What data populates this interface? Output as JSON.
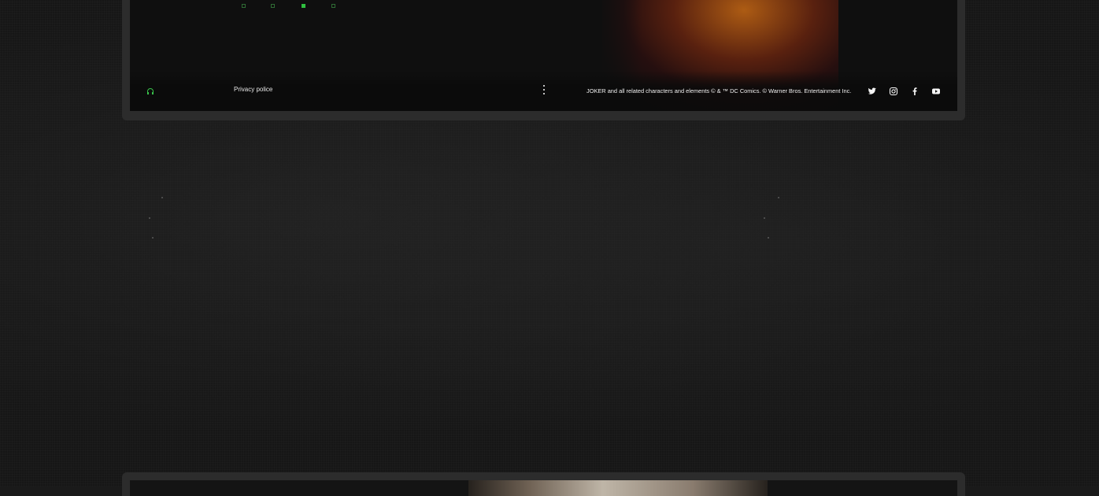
{
  "slider": {
    "dots": [
      {
        "state": "inactive"
      },
      {
        "state": "inactive"
      },
      {
        "state": "active"
      },
      {
        "state": "inactive"
      }
    ]
  },
  "footer": {
    "audio_icon": "headphones-icon",
    "privacy_label": "Privacy police",
    "menu_icon": "vertical-dots-icon",
    "copyright": "JOKER and all related characters and elements © & ™ DC Comics. © Warner Bros. Entertainment Inc.",
    "social": [
      {
        "name": "twitter",
        "icon": "twitter-icon"
      },
      {
        "name": "instagram",
        "icon": "instagram-icon"
      },
      {
        "name": "facebook",
        "icon": "facebook-icon"
      },
      {
        "name": "youtube",
        "icon": "youtube-icon"
      }
    ]
  },
  "colors": {
    "accent_green": "#2fbf3f",
    "frame": "#2c2c2c",
    "background": "#161616",
    "text": "#f0f0f0"
  }
}
